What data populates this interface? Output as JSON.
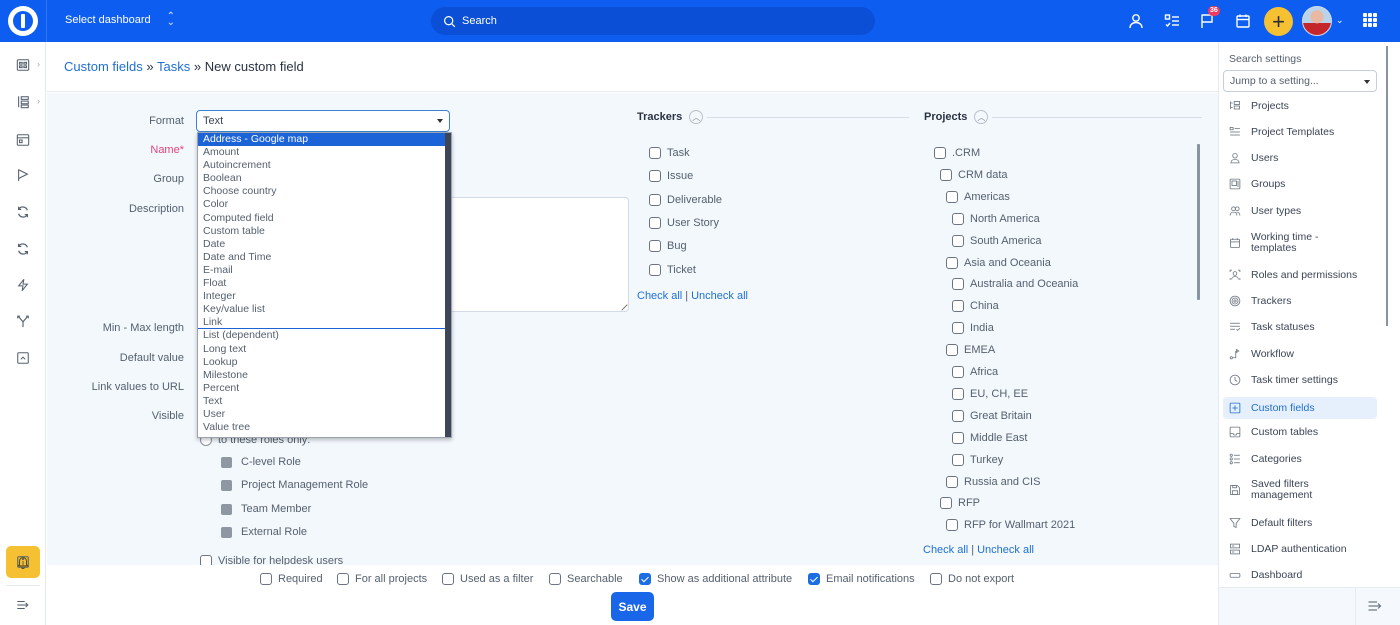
{
  "topbar": {
    "dashboard_select": "Select dashboard",
    "search_placeholder": "Search",
    "notifications_count": "36",
    "add_label": "+"
  },
  "breadcrumb": {
    "items": [
      "Custom fields",
      "Tasks"
    ],
    "separator": "»",
    "current": "New custom field"
  },
  "form": {
    "labels": {
      "format": "Format",
      "name": "Name*",
      "group": "Group",
      "description": "Description",
      "min_max": "Min - Max length",
      "default_value": "Default value",
      "link_values": "Link values to URL",
      "visible": "Visible"
    },
    "format_value": "Text",
    "format_options": [
      "Address - Google map",
      "Amount",
      "Autoincrement",
      "Boolean",
      "Choose country",
      "Color",
      "Computed field",
      "Custom table",
      "Date",
      "Date and Time",
      "E-mail",
      "Float",
      "Integer",
      "Key/value list",
      "Link",
      "List (dependent)",
      "Long text",
      "Lookup",
      "Milestone",
      "Percent",
      "Text",
      "User",
      "Value tree"
    ],
    "highlighted_option": "Address - Google map",
    "roles_radio": "to these roles only:",
    "roles": [
      "C-level Role",
      "Project Management Role",
      "Team Member",
      "External Role"
    ],
    "helpdesk": "Visible for helpdesk users"
  },
  "trackers": {
    "title": "Trackers",
    "items": [
      "Task",
      "Issue",
      "Deliverable",
      "User Story",
      "Bug",
      "Ticket"
    ],
    "check_all": "Check all",
    "uncheck_all": "Uncheck all"
  },
  "projects": {
    "title": "Projects",
    "items": [
      {
        "label": ".CRM",
        "level": 0
      },
      {
        "label": "CRM data",
        "level": 1
      },
      {
        "label": "Americas",
        "level": 2
      },
      {
        "label": "North America",
        "level": 3
      },
      {
        "label": "South America",
        "level": 3
      },
      {
        "label": "Asia and Oceania",
        "level": 2
      },
      {
        "label": "Australia and Oceania",
        "level": 3
      },
      {
        "label": "China",
        "level": 3
      },
      {
        "label": "India",
        "level": 3
      },
      {
        "label": "EMEA",
        "level": 2
      },
      {
        "label": "Africa",
        "level": 3
      },
      {
        "label": "EU, CH, EE",
        "level": 3
      },
      {
        "label": "Great Britain",
        "level": 3
      },
      {
        "label": "Middle East",
        "level": 3
      },
      {
        "label": "Turkey",
        "level": 3
      },
      {
        "label": "Russia and CIS",
        "level": 2
      },
      {
        "label": "RFP",
        "level": 1
      },
      {
        "label": "RFP for Wallmart 2021",
        "level": 2
      }
    ],
    "check_all": "Check all",
    "uncheck_all": "Uncheck all"
  },
  "options": [
    {
      "label": "Required",
      "checked": false
    },
    {
      "label": "For all projects",
      "checked": false
    },
    {
      "label": "Used as a filter",
      "checked": false
    },
    {
      "label": "Searchable",
      "checked": false
    },
    {
      "label": "Show as additional attribute",
      "checked": true
    },
    {
      "label": "Email notifications",
      "checked": true
    },
    {
      "label": "Do not export",
      "checked": false
    }
  ],
  "save_label": "Save",
  "settings_panel": {
    "title": "Search settings",
    "jump_placeholder": "Jump to a setting...",
    "items": [
      {
        "label": "Projects",
        "icon": "projects-icon"
      },
      {
        "label": "Project Templates",
        "icon": "templates-icon"
      },
      {
        "label": "Users",
        "icon": "user-icon"
      },
      {
        "label": "Groups",
        "icon": "groups-icon"
      },
      {
        "label": "User types",
        "icon": "user-types-icon"
      },
      {
        "label": "Working time - templates",
        "icon": "calendar-icon"
      },
      {
        "label": "Roles and permissions",
        "icon": "roles-icon"
      },
      {
        "label": "Trackers",
        "icon": "trackers-icon"
      },
      {
        "label": "Task statuses",
        "icon": "statuses-icon"
      },
      {
        "label": "Workflow",
        "icon": "workflow-icon"
      },
      {
        "label": "Task timer settings",
        "icon": "clock-icon"
      },
      {
        "label": "Custom fields",
        "icon": "plus-square-icon",
        "active": true
      },
      {
        "label": "Custom tables",
        "icon": "table-icon"
      },
      {
        "label": "Categories",
        "icon": "categories-icon"
      },
      {
        "label": "Saved filters management",
        "icon": "save-icon"
      },
      {
        "label": "Default filters",
        "icon": "filter-icon"
      },
      {
        "label": "LDAP authentication",
        "icon": "server-icon"
      },
      {
        "label": "Dashboard",
        "icon": "dashboard-icon"
      }
    ]
  }
}
